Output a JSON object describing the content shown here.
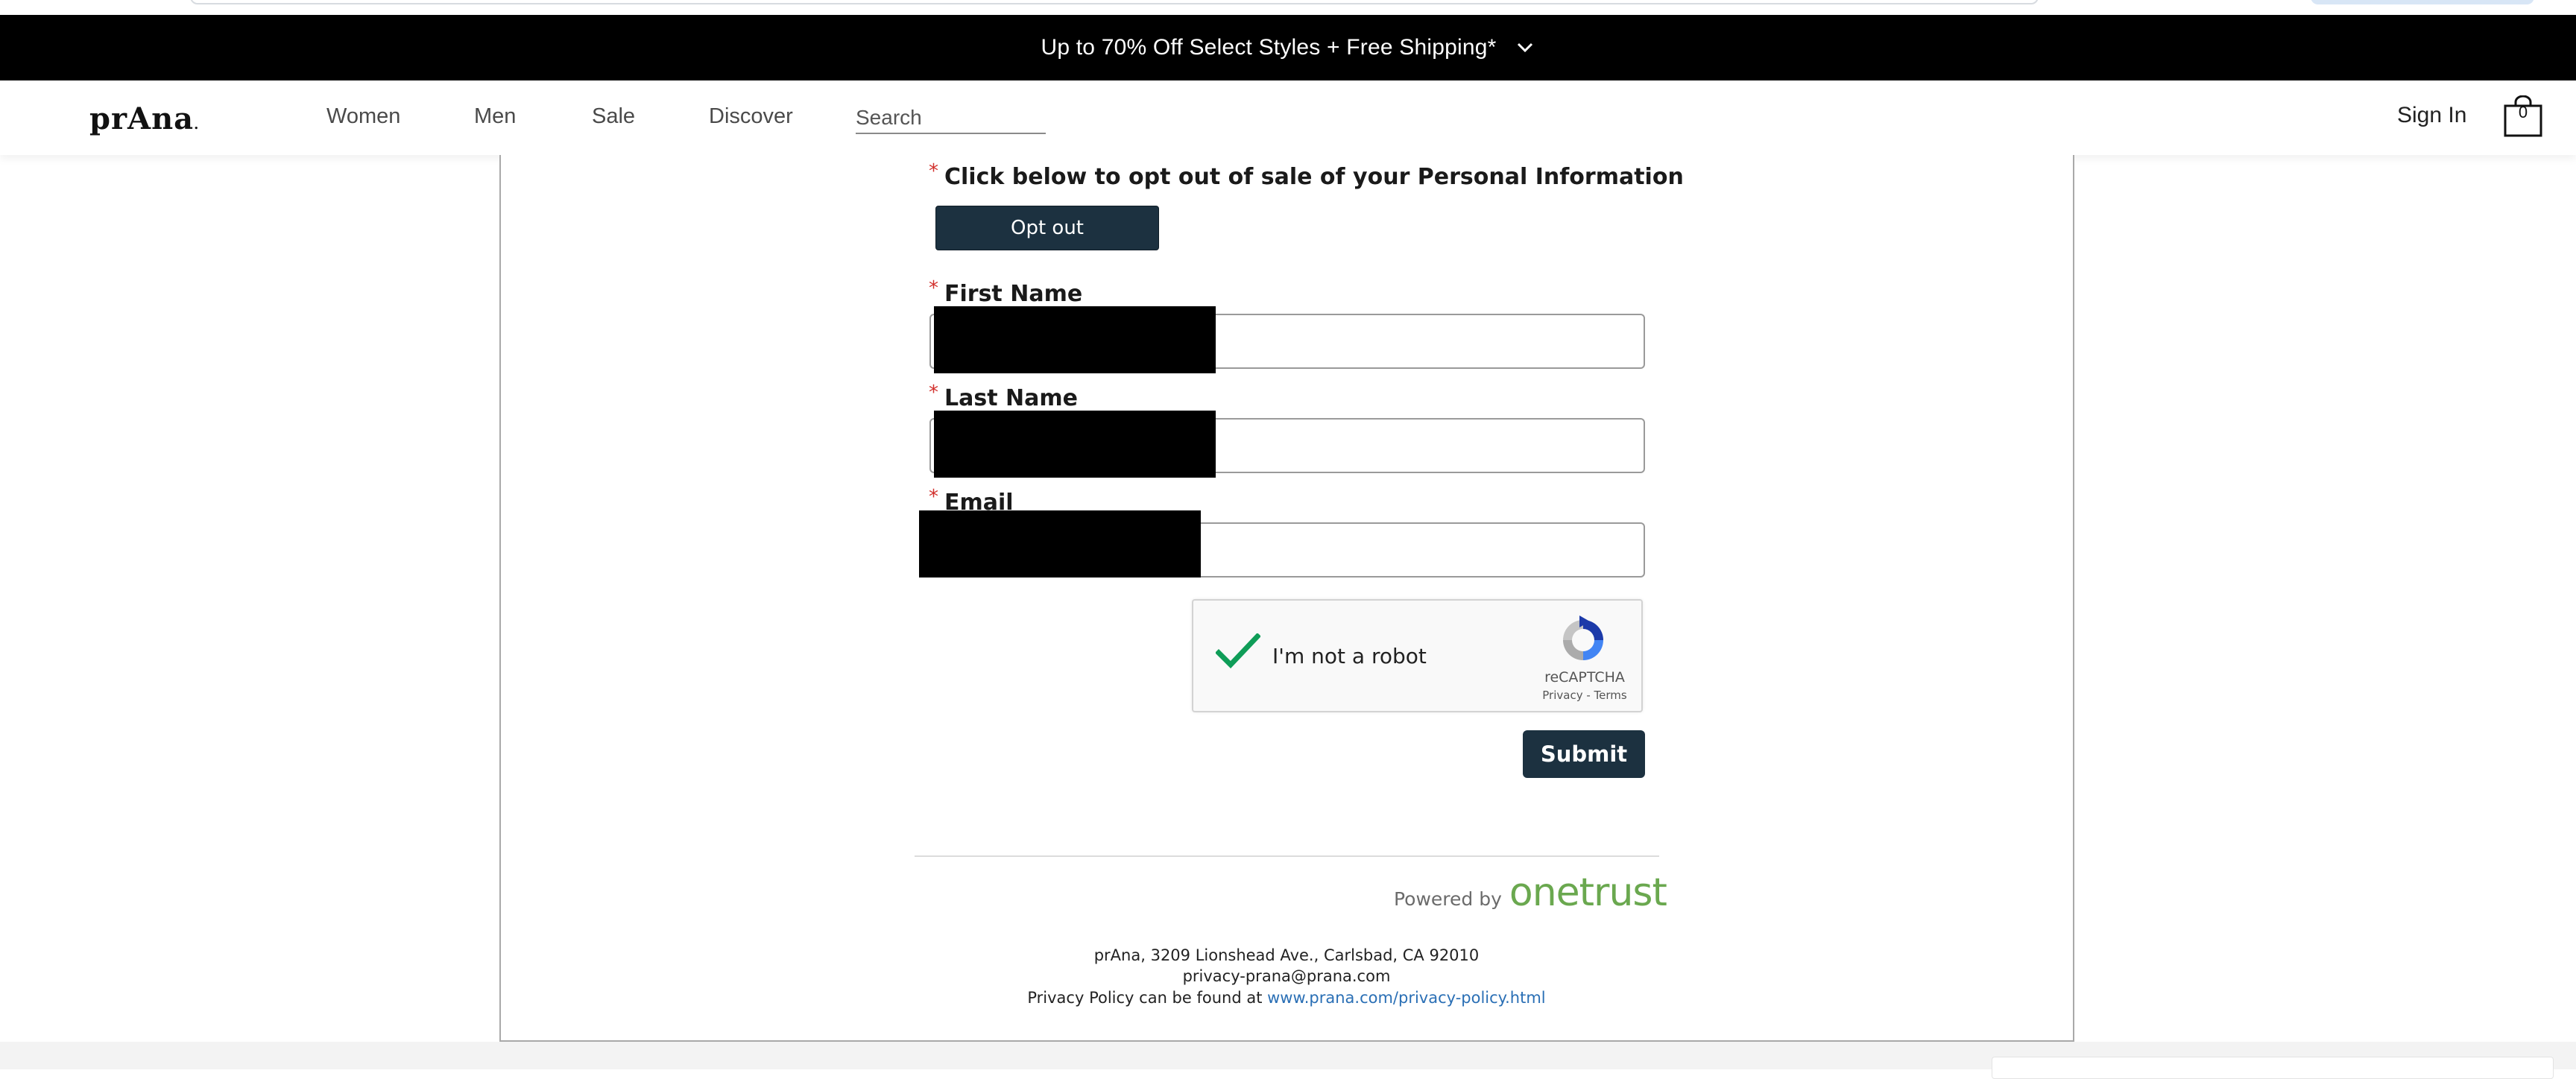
{
  "promo": {
    "text": "Up to 70% Off Select Styles + Free Shipping*"
  },
  "header": {
    "logo": "prAna",
    "logo_dot": ".",
    "nav": [
      "Women",
      "Men",
      "Sale",
      "Discover"
    ],
    "search_placeholder": "Search",
    "sign_in": "Sign In",
    "cart_count": "0"
  },
  "form": {
    "optout_label": "Click below to opt out of sale of your Personal Information",
    "optout_button": "Opt out",
    "first_name_label": "First Name",
    "last_name_label": "Last Name",
    "email_label": "Email",
    "required_marker": "*",
    "submit_label": "Submit"
  },
  "recaptcha": {
    "label": "I'm not a robot",
    "brand": "reCAPTCHA",
    "privacy": "Privacy",
    "separator": " - ",
    "terms": "Terms",
    "checked": true
  },
  "footer": {
    "powered_by": "Powered by",
    "onetrust": "onetrust",
    "address": "prAna, 3209 Lionshead Ave., Carlsbad, CA 92010",
    "email": "privacy-prana@prana.com",
    "policy_prefix": "Privacy Policy can be found at ",
    "policy_link": "www.prana.com/privacy-policy.html"
  },
  "colors": {
    "promo_bg": "#000000",
    "button_bg": "#1c3140",
    "required": "#d2302c",
    "onetrust_green": "#6aa84f",
    "link": "#2a6fb5",
    "check_green": "#0f9d58"
  }
}
